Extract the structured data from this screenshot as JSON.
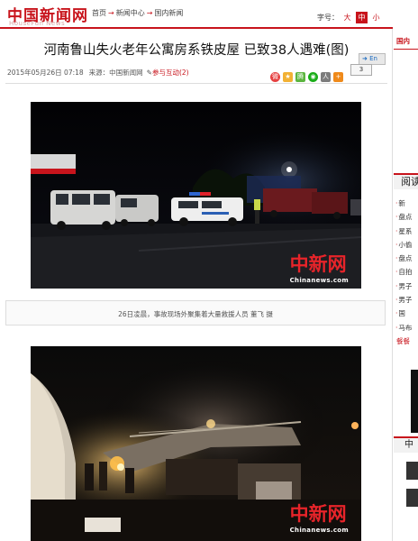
{
  "header": {
    "logo": "中国新闻网",
    "logo_sub": "HouseFun News",
    "breadcrumb": [
      "首页",
      "新闻中心",
      "国内新闻"
    ],
    "breadcrumb_separator": "→",
    "font_size_label": "字号：",
    "font_sizes": [
      "大",
      "中",
      "小"
    ],
    "font_size_selected": "中"
  },
  "article": {
    "title": "河南鲁山失火老年公寓房系铁皮屋 已致38人遇难(图)",
    "date": "2015年05月26日 07:18",
    "source": "来源：中国新闻网",
    "interact": "参与互动(2)",
    "share_count": "3",
    "forward": "En",
    "photos": [
      {
        "watermark_cn": "中新网",
        "watermark_en": "Chinanews.com",
        "caption": "26日凌晨，事故现场外聚集着大量救援人员  董飞  摄"
      },
      {
        "watermark_cn": "中新网",
        "watermark_en": "Chinanews.com"
      }
    ]
  },
  "sidebar": {
    "header": "国内",
    "tab1": "阅读",
    "items": [
      {
        "dot": "·",
        "text": "新"
      },
      {
        "dot": "·",
        "text": "盘点"
      },
      {
        "dot": "·",
        "text": "星系"
      },
      {
        "dot": "·",
        "text": "小偷"
      },
      {
        "dot": "·",
        "text": "盘点"
      },
      {
        "dot": "·",
        "text": "自拍"
      },
      {
        "dot": "·",
        "text": "男子"
      },
      {
        "dot": "·",
        "text": "男子"
      },
      {
        "dot": "·",
        "text": "国"
      },
      {
        "dot": "·",
        "text": "马布"
      },
      {
        "dot": "",
        "text": "餐餐"
      }
    ],
    "tab2": "中"
  },
  "colors": {
    "brand_red": "#c8141c",
    "text": "#111111",
    "meta": "#555555"
  }
}
